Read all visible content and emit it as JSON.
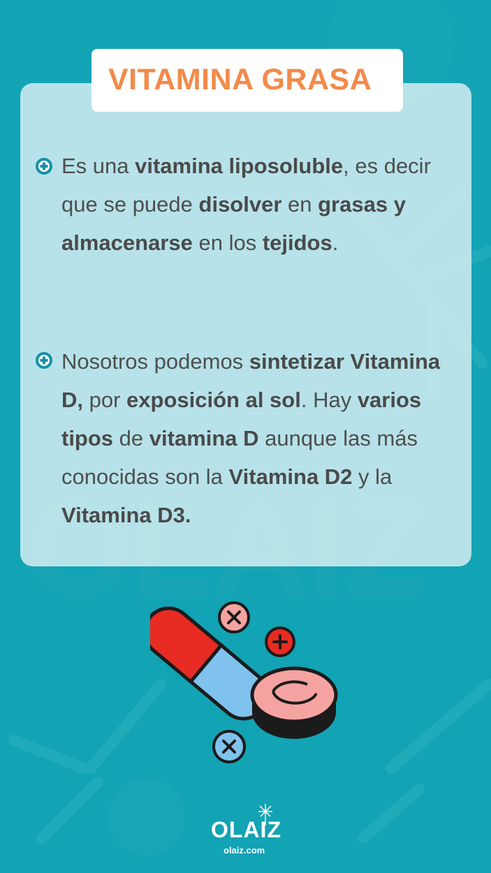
{
  "title": "VITAMINA GRASA",
  "bullets": [
    {
      "segments": [
        {
          "text": "Es una ",
          "bold": false
        },
        {
          "text": "vitamina liposoluble",
          "bold": true
        },
        {
          "text": ", es decir que se puede ",
          "bold": false
        },
        {
          "text": "disolver",
          "bold": true
        },
        {
          "text": " en ",
          "bold": false
        },
        {
          "text": "grasas y almacenarse",
          "bold": true
        },
        {
          "text": " en los ",
          "bold": false
        },
        {
          "text": "tejidos",
          "bold": true
        },
        {
          "text": ".",
          "bold": false
        }
      ]
    },
    {
      "segments": [
        {
          "text": "Nosotros podemos ",
          "bold": false
        },
        {
          "text": "sintetizar Vitamina D,",
          "bold": true
        },
        {
          "text": " por ",
          "bold": false
        },
        {
          "text": "exposición al sol",
          "bold": true
        },
        {
          "text": ". Hay ",
          "bold": false
        },
        {
          "text": "varios tipos",
          "bold": true
        },
        {
          "text": " de ",
          "bold": false
        },
        {
          "text": "vitamina D",
          "bold": true
        },
        {
          "text": " aunque las más conocidas son la ",
          "bold": false
        },
        {
          "text": "Vitamina D2",
          "bold": true
        },
        {
          "text": " y la ",
          "bold": false
        },
        {
          "text": "Vitamina D3.",
          "bold": true
        }
      ]
    }
  ],
  "brand": {
    "logo": "OLAIZ",
    "domain": "olaiz.com"
  },
  "colors": {
    "background": "#12a3b4",
    "title": "#f28a4a",
    "bullet_icon": "#1590a8"
  },
  "icons": [
    "plus-circle-bullet-icon",
    "capsule-pill-icon",
    "tablet-pill-icon",
    "plus-sign-icon",
    "times-sign-icon",
    "dandelion-logo-icon"
  ]
}
